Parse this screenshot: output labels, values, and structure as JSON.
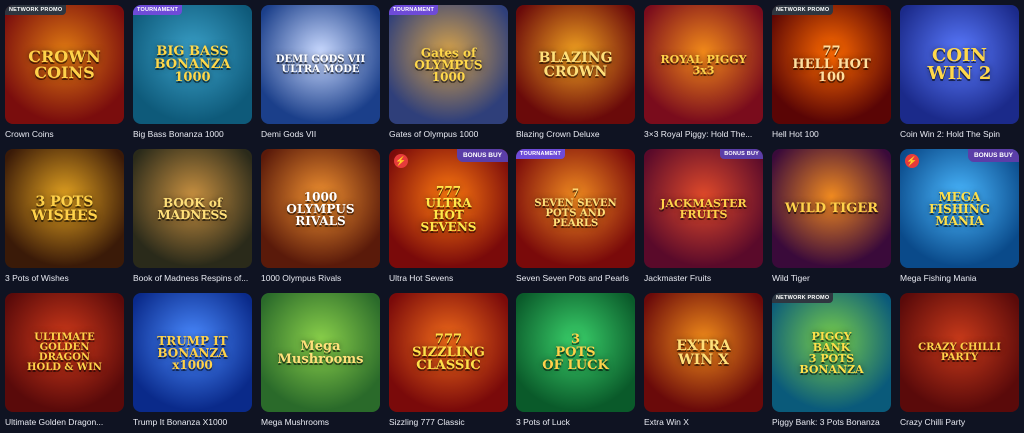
{
  "games": [
    {
      "title": "Crown Coins",
      "logo": "CROWN\nCOINS",
      "badge": "NETWORK PROMO",
      "badge_color": "#2f3640",
      "bg": [
        "#7a0d0d",
        "#e07a12"
      ],
      "fg": "#ffd24a",
      "logo_size": 16
    },
    {
      "title": "Big Bass Bonanza 1000",
      "logo": "BIG BASS\nBONANZA\n1000",
      "badge": "TOURNAMENT",
      "badge_color": "#6e4bd8",
      "bg": [
        "#0e5a7a",
        "#3aa0c8"
      ],
      "fg": "#ffd84a",
      "logo_size": 13
    },
    {
      "title": "Demi Gods VII",
      "logo": "DEMI GODS VII\nULTRA MODE",
      "badge": "",
      "badge_color": "",
      "bg": [
        "#1b3f8a",
        "#c9d9ff"
      ],
      "fg": "#ffffff",
      "logo_size": 10
    },
    {
      "title": "Gates of Olympus 1000",
      "logo": "Gates of\nOLYMPUS\n1000",
      "badge": "TOURNAMENT",
      "badge_color": "#6e4bd8",
      "bg": [
        "#2f3f7a",
        "#d6a24a"
      ],
      "fg": "#ffd84a",
      "logo_size": 12
    },
    {
      "title": "Blazing Crown Deluxe",
      "logo": "BLAZING\nCROWN",
      "badge": "",
      "badge_color": "",
      "bg": [
        "#6a0a0a",
        "#f0a020"
      ],
      "fg": "#ffe07a",
      "logo_size": 14
    },
    {
      "title": "3×3 Royal Piggy: Hold The...",
      "logo": "ROYAL PIGGY\n3x3",
      "badge": "",
      "badge_color": "",
      "bg": [
        "#7a0c1c",
        "#f28a1a"
      ],
      "fg": "#ffd24a",
      "logo_size": 11
    },
    {
      "title": "Hell Hot 100",
      "logo": "77\nHELL HOT\n100",
      "badge": "NETWORK PROMO",
      "badge_color": "#2f3640",
      "bg": [
        "#5a0505",
        "#ff6a00"
      ],
      "fg": "#ffe0a0",
      "logo_size": 13
    },
    {
      "title": "Coin Win 2: Hold The Spin",
      "logo": "COIN\nWIN 2",
      "badge": "",
      "badge_color": "",
      "bg": [
        "#1b2a8a",
        "#5a7aff"
      ],
      "fg": "#ffd84a",
      "logo_size": 18
    },
    {
      "title": "3 Pots of Wishes",
      "logo": "3 POTS\nWISHES",
      "badge": "",
      "badge_color": "",
      "bg": [
        "#3a1a08",
        "#e0a020"
      ],
      "fg": "#ffd24a",
      "logo_size": 14
    },
    {
      "title": "Book of Madness Respins of...",
      "logo": "BOOK of\nMADNESS",
      "badge": "",
      "badge_color": "",
      "bg": [
        "#2a2a1a",
        "#c89040"
      ],
      "fg": "#ffe07a",
      "logo_size": 12
    },
    {
      "title": "1000 Olympus Rivals",
      "logo": "1000\nOLYMPUS\nRIVALS",
      "badge": "",
      "badge_color": "",
      "bg": [
        "#5a1a0a",
        "#f09030"
      ],
      "fg": "#ffffff",
      "logo_size": 12
    },
    {
      "title": "Ultra Hot Sevens",
      "logo": "777\nULTRA\nHOT\nSEVENS",
      "badge": "",
      "badge_color": "",
      "bg": [
        "#7a0a0a",
        "#ff7a10"
      ],
      "fg": "#ffe84a",
      "logo_size": 12
    },
    {
      "title": "Seven Seven Pots and Pearls",
      "logo": "7\nSEVEN SEVEN\nPOTS AND PEARLS",
      "badge": "TOURNAMENT",
      "badge_color": "#6e4bd8",
      "bg": [
        "#7a0a0a",
        "#f08a20"
      ],
      "fg": "#ffe07a",
      "logo_size": 10
    },
    {
      "title": "Jackmaster Fruits",
      "logo": "JACKMASTER\nFRUITS",
      "badge": "BONUS BUY",
      "badge_color": "#5b3ea8",
      "bg": [
        "#5a0a2a",
        "#e04a2a"
      ],
      "fg": "#ffd24a",
      "logo_size": 11
    },
    {
      "title": "Wild Tiger",
      "logo": "WILD TIGER",
      "badge": "",
      "badge_color": "",
      "bg": [
        "#3a0a3a",
        "#f08a20"
      ],
      "fg": "#ffd24a",
      "logo_size": 13
    },
    {
      "title": "Mega Fishing Mania",
      "logo": "MEGA\nFISHING\nMANIA",
      "badge": "",
      "badge_color": "",
      "bg": [
        "#0a4a8a",
        "#4ab8ff"
      ],
      "fg": "#ffe04a",
      "logo_size": 12
    },
    {
      "title": "Ultimate Golden Dragon...",
      "logo": "ULTIMATE\nGOLDEN\nDRAGON\nHOLD & WIN",
      "badge": "",
      "badge_color": "",
      "bg": [
        "#5a0a0a",
        "#d03a1a"
      ],
      "fg": "#ffd24a",
      "logo_size": 10
    },
    {
      "title": "Trump It Bonanza X1000",
      "logo": "TRUMP IT\nBONANZA\nx1000",
      "badge": "",
      "badge_color": "",
      "bg": [
        "#0a2a8a",
        "#4a8aff"
      ],
      "fg": "#ffd24a",
      "logo_size": 12
    },
    {
      "title": "Mega Mushrooms",
      "logo": "Mega\nMushrooms",
      "badge": "",
      "badge_color": "",
      "bg": [
        "#2a6a2a",
        "#8ad04a"
      ],
      "fg": "#ffe07a",
      "logo_size": 13
    },
    {
      "title": "Sizzling 777 Classic",
      "logo": "777\nSIZZLING\nCLASSIC",
      "badge": "",
      "badge_color": "",
      "bg": [
        "#7a0a0a",
        "#f06a1a"
      ],
      "fg": "#ffe04a",
      "logo_size": 13
    },
    {
      "title": "3 Pots of Luck",
      "logo": "3\nPOTS\nOF LUCK",
      "badge": "",
      "badge_color": "",
      "bg": [
        "#0a5a2a",
        "#3ad06a"
      ],
      "fg": "#ffd24a",
      "logo_size": 13
    },
    {
      "title": "Extra Win X",
      "logo": "EXTRA\nWIN X",
      "badge": "",
      "badge_color": "",
      "bg": [
        "#6a0a0a",
        "#f08a1a"
      ],
      "fg": "#ffe07a",
      "logo_size": 14
    },
    {
      "title": "Piggy Bank: 3 Pots Bonanza",
      "logo": "PIGGY\nBANK\n3 POTS BONANZA",
      "badge": "NETWORK PROMO",
      "badge_color": "#2f3640",
      "bg": [
        "#0a5a7a",
        "#7ad04a"
      ],
      "fg": "#ffe04a",
      "logo_size": 11
    },
    {
      "title": "Crazy Chilli Party",
      "logo": "CRAZY CHILLI\nPARTY",
      "badge": "",
      "badge_color": "",
      "bg": [
        "#5a0a0a",
        "#c83a1a"
      ],
      "fg": "#ffd24a",
      "logo_size": 10
    }
  ],
  "extras": {
    "bonus_buy_label": "BONUS BUY"
  }
}
